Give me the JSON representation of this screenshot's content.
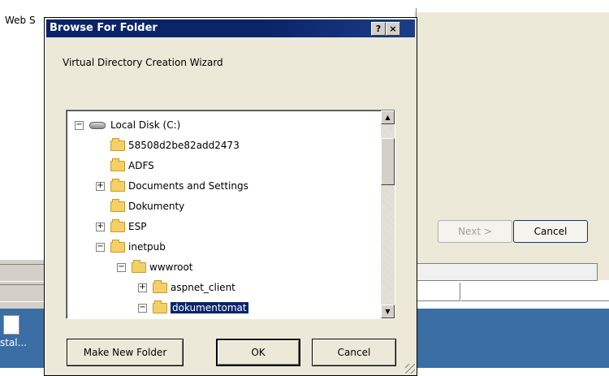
{
  "background": {
    "wizard_label": "Web S",
    "next_button": "Next >",
    "cancel_button": "Cancel",
    "desktop_icon_label": "stal..."
  },
  "dialog": {
    "title": "Browse For Folder",
    "help_button": "?",
    "close_button": "×",
    "description": "Virtual Directory Creation Wizard",
    "tree": [
      {
        "label": "Local Disk (C:)",
        "icon": "disk-icon",
        "expander": "−",
        "level": 0
      },
      {
        "label": "58508d2be82add2473",
        "icon": "folder-icon",
        "expander": "",
        "level": 1
      },
      {
        "label": "ADFS",
        "icon": "folder-icon",
        "expander": "",
        "level": 1
      },
      {
        "label": "Documents and Settings",
        "icon": "folder-icon",
        "expander": "+",
        "level": 1
      },
      {
        "label": "Dokumenty",
        "icon": "folder-icon",
        "expander": "",
        "level": 1
      },
      {
        "label": "ESP",
        "icon": "folder-icon",
        "expander": "+",
        "level": 1
      },
      {
        "label": "inetpub",
        "icon": "folder-icon",
        "expander": "−",
        "level": 1
      },
      {
        "label": "wwwroot",
        "icon": "folder-icon",
        "expander": "−",
        "level": 2
      },
      {
        "label": "aspnet_client",
        "icon": "folder-icon",
        "expander": "+",
        "level": 3
      },
      {
        "label": "dokumentomat",
        "icon": "folder-open-icon",
        "expander": "−",
        "level": 3,
        "selected": true
      }
    ],
    "buttons": {
      "make_new_folder": "Make New Folder",
      "ok": "OK",
      "cancel": "Cancel"
    }
  },
  "colors": {
    "titlebar": "#0a246a",
    "dialog_face": "#ece9d8",
    "desktop": "#3a6ea5",
    "selection": "#0a246a"
  }
}
